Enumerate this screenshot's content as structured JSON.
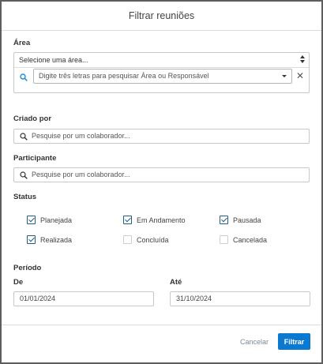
{
  "modal": {
    "title": "Filtrar reuniões"
  },
  "area": {
    "label": "Área",
    "select_value": "Selecione uma área...",
    "search_placeholder": "Digite três letras para pesquisar Área ou Responsável",
    "clear_symbol": "✕"
  },
  "criado_por": {
    "label": "Criado por",
    "placeholder": "Pesquise por um colaborador..."
  },
  "participante": {
    "label": "Participante",
    "placeholder": "Pesquise por um colaborador..."
  },
  "status": {
    "label": "Status",
    "options": [
      {
        "label": "Planejada",
        "checked": true
      },
      {
        "label": "Em Andamento",
        "checked": true
      },
      {
        "label": "Pausada",
        "checked": true
      },
      {
        "label": "Realizada",
        "checked": true
      },
      {
        "label": "Concluída",
        "checked": false
      },
      {
        "label": "Cancelada",
        "checked": false
      }
    ]
  },
  "periodo": {
    "label": "Período",
    "de_label": "De",
    "de_value": "01/01/2024",
    "ate_label": "Até",
    "ate_value": "31/10/2024"
  },
  "footer": {
    "cancel_label": "Cancelar",
    "filter_label": "Filtrar"
  },
  "colors": {
    "primary": "#0b79d0",
    "checkbox": "#1f5f8b"
  }
}
